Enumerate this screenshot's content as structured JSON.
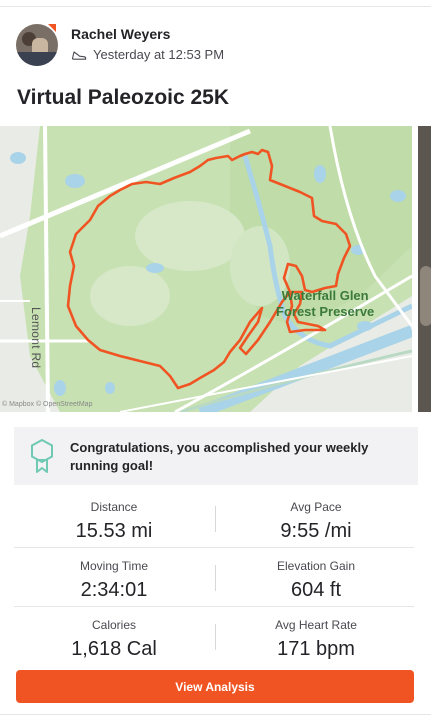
{
  "user": {
    "name": "Rachel Weyers",
    "timestamp": "Yesterday at 12:53 PM",
    "activity_icon": "shoe-icon"
  },
  "activity": {
    "title": "Virtual Paleozoic 25K"
  },
  "map": {
    "road_label": "Lemont Rd",
    "place_label_line1": "Waterfall Glen",
    "place_label_line2": "Forest Preserve",
    "attribution": "© Mapbox © OpenStreetMap",
    "route_color": "#f05422"
  },
  "goal": {
    "message": "Congratulations, you accomplished your weekly running goal!"
  },
  "stats": [
    {
      "label": "Distance",
      "value": "15.53 mi"
    },
    {
      "label": "Avg Pace",
      "value": "9:55 /mi"
    },
    {
      "label": "Moving Time",
      "value": "2:34:01"
    },
    {
      "label": "Elevation Gain",
      "value": "604 ft"
    },
    {
      "label": "Calories",
      "value": "1,618 Cal"
    },
    {
      "label": "Avg Heart Rate",
      "value": "171 bpm"
    }
  ],
  "actions": {
    "view_analysis": "View Analysis"
  },
  "colors": {
    "accent": "#f05422",
    "text": "#242428",
    "secondary_text": "#494950",
    "goal_bg": "#f2f2f5"
  }
}
